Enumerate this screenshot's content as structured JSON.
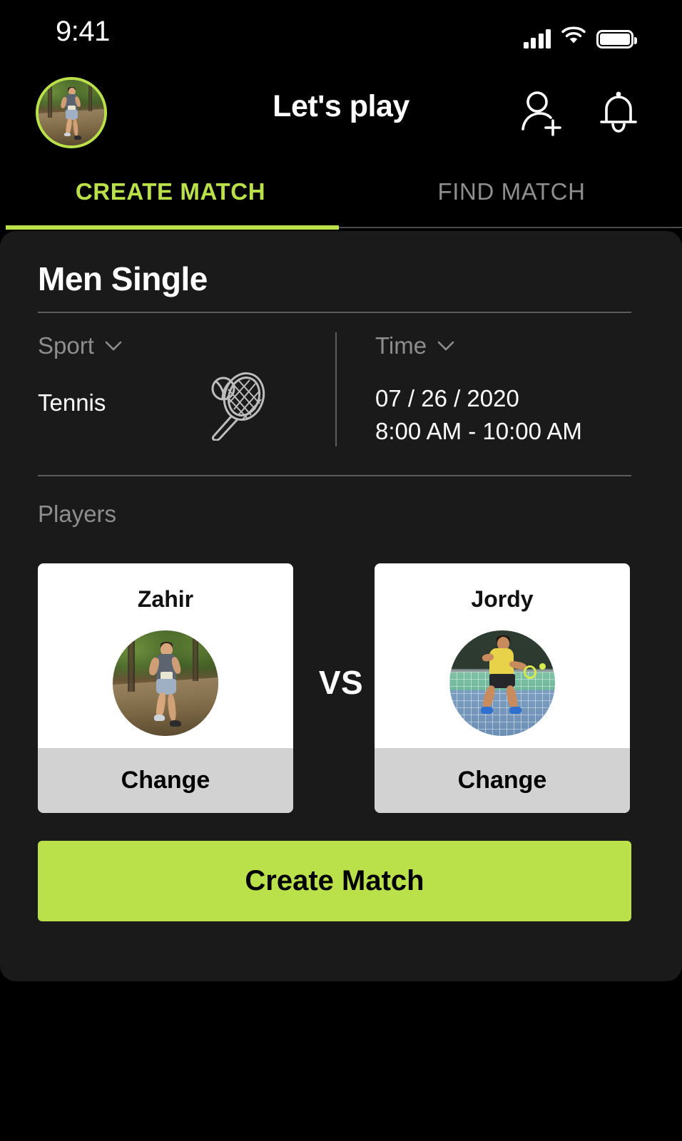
{
  "status_bar": {
    "time": "9:41",
    "icons": [
      "cellular-signal-icon",
      "wifi-icon",
      "battery-icon"
    ],
    "signal_bars": 4,
    "battery_full": true
  },
  "header": {
    "title": "Let's play",
    "avatar_name": "avatar",
    "avatar_ring_color": "#bae04a",
    "actions": [
      {
        "name": "add-person-icon",
        "label": "Add friend"
      },
      {
        "name": "bell-icon",
        "label": "Notifications"
      }
    ]
  },
  "tabs": {
    "active_index": 0,
    "items": [
      {
        "label": "CREATE MATCH",
        "active": true
      },
      {
        "label": "FIND MATCH",
        "active": false
      }
    ],
    "active_color": "#bae04a",
    "inactive_color": "#8e8e8e"
  },
  "match": {
    "title": "Men Single",
    "sport": {
      "label": "Sport",
      "value": "Tennis",
      "icon": "tennis-racket-icon"
    },
    "time": {
      "label": "Time",
      "date": "07 / 26 / 2020",
      "range": "8:00 AM - 10:00 AM"
    },
    "players_label": "Players",
    "vs_label": "VS",
    "players": [
      {
        "name": "Zahir",
        "photo": "runner-photo",
        "change_label": "Change"
      },
      {
        "name": "Jordy",
        "photo": "tennis-player-photo",
        "change_label": "Change"
      }
    ],
    "create_button": {
      "label": "Create Match",
      "color": "#bae04a",
      "text_color": "#000000"
    }
  }
}
